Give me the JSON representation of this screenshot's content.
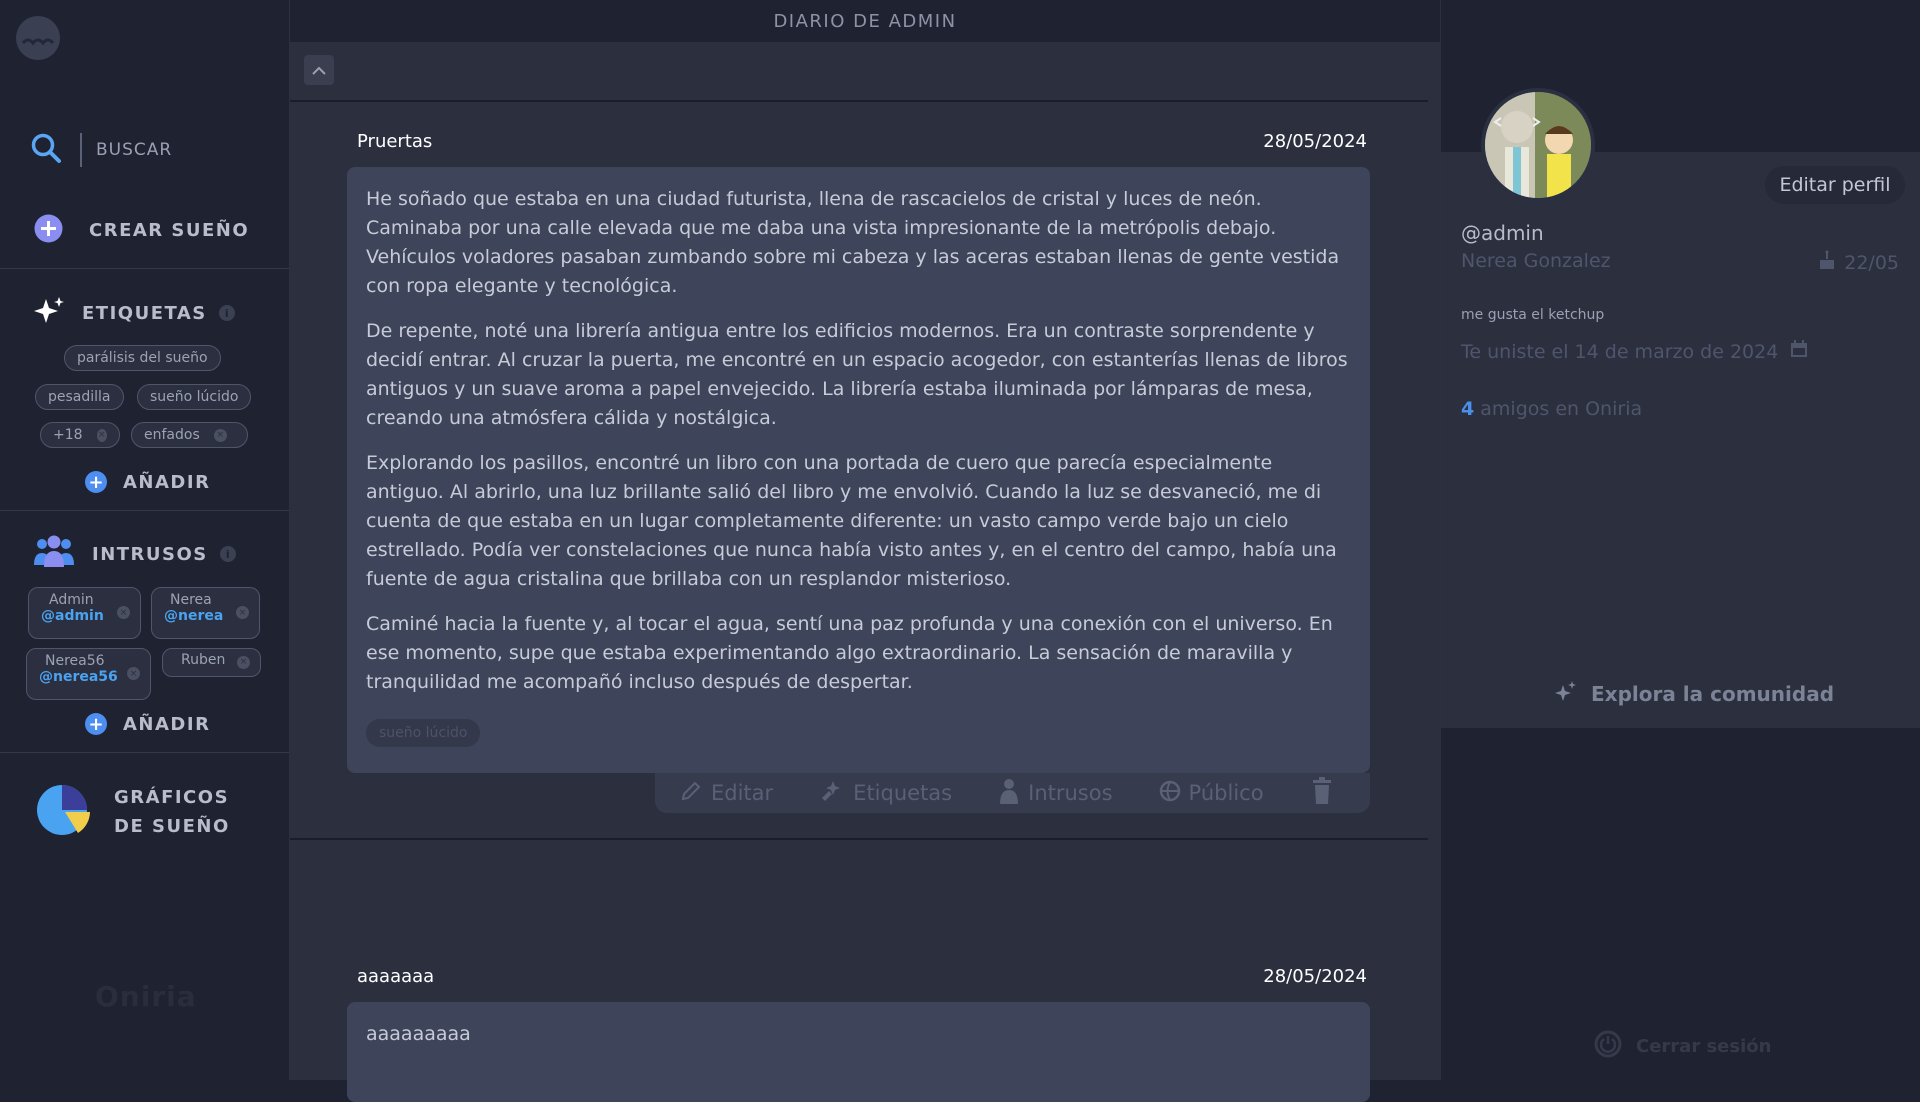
{
  "sidebar": {
    "search_placeholder": "BUSCAR",
    "create_label": "CREAR SUEÑO",
    "tags_title": "ETIQUETAS",
    "tags": [
      "parálisis del sueño",
      "pesadilla",
      "sueño lúcido",
      "+18",
      "enfados"
    ],
    "add_label": "AÑADIR",
    "intruders_title": "INTRUSOS",
    "intruders": [
      {
        "name": "Admin",
        "handle": "@admin"
      },
      {
        "name": "Nerea",
        "handle": "@nerea"
      },
      {
        "name": "Nerea56",
        "handle": "@nerea56"
      },
      {
        "name": "Ruben",
        "handle": ""
      }
    ],
    "charts_line1": "GRÁFICOS",
    "charts_line2": "DE SUEÑO",
    "brand": "Oniria",
    "info_glyph": "i",
    "remove_glyph": "×"
  },
  "main": {
    "page_title": "DIARIO DE ADMIN",
    "dreams": [
      {
        "title": "Pruertas",
        "date": "28/05/2024",
        "paragraphs": [
          "He soñado que estaba en una ciudad futurista, llena de rascacielos de cristal y luces de neón. Caminaba por una calle elevada que me daba una vista impresionante de la metrópolis debajo. Vehículos voladores pasaban zumbando sobre mi cabeza y las aceras estaban llenas de gente vestida con ropa elegante y tecnológica.",
          "De repente, noté una librería antigua entre los edificios modernos. Era un contraste sorprendente y decidí entrar. Al cruzar la puerta, me encontré en un espacio acogedor, con estanterías llenas de libros antiguos y un suave aroma a papel envejecido. La librería estaba iluminada por lámparas de mesa, creando una atmósfera cálida y nostálgica.",
          "Explorando los pasillos, encontré un libro con una portada de cuero que parecía especialmente antiguo. Al abrirlo, una luz brillante salió del libro y me envolvió. Cuando la luz se desvaneció, me di cuenta de que estaba en un lugar completamente diferente: un vasto campo verde bajo un cielo estrellado. Podía ver constelaciones que nunca había visto antes y, en el centro del campo, había una fuente de agua cristalina que brillaba con un resplandor misterioso.",
          "Caminé hacia la fuente y, al tocar el agua, sentí una paz profunda y una conexión con el universo. En ese momento, supe que estaba experimentando algo extraordinario. La sensación de maravilla y tranquilidad me acompañó incluso después de despertar."
        ],
        "tag": "sueño lúcido",
        "actions": {
          "edit": "Editar",
          "tags": "Etiquetas",
          "intruders": "Intrusos",
          "public": "Público"
        }
      },
      {
        "title": "aaaaaaa",
        "date": "28/05/2024",
        "text": "aaaaaaaaa"
      }
    ]
  },
  "profile": {
    "edit_button": "Editar perfil",
    "handle": "@admin",
    "name": "Nerea Gonzalez",
    "birthday": "22/05",
    "bio": "me gusta el ketchup",
    "joined": "Te uniste el 14 de marzo de 2024",
    "friends_count": "4",
    "friends_label": "amigos en Oniria",
    "explore": "Explora la comunidad",
    "logout": "Cerrar sesión"
  },
  "colors": {
    "background": "#1f2230",
    "panel": "#2b2f3e",
    "card": "#3e4459",
    "accent_blue": "#4d8ef0",
    "handle_blue": "#4aa3f0"
  },
  "icons": [
    "moon-logo-icon",
    "search-icon",
    "plus-circle-icon",
    "sparkles-icon",
    "info-icon",
    "users-icon",
    "pie-chart-icon",
    "chevron-up-icon",
    "pencil-icon",
    "tag-icon",
    "user-icon",
    "globe-icon",
    "trash-icon",
    "cake-icon",
    "calendar-icon",
    "sparkle-icon",
    "power-icon",
    "close-icon"
  ]
}
